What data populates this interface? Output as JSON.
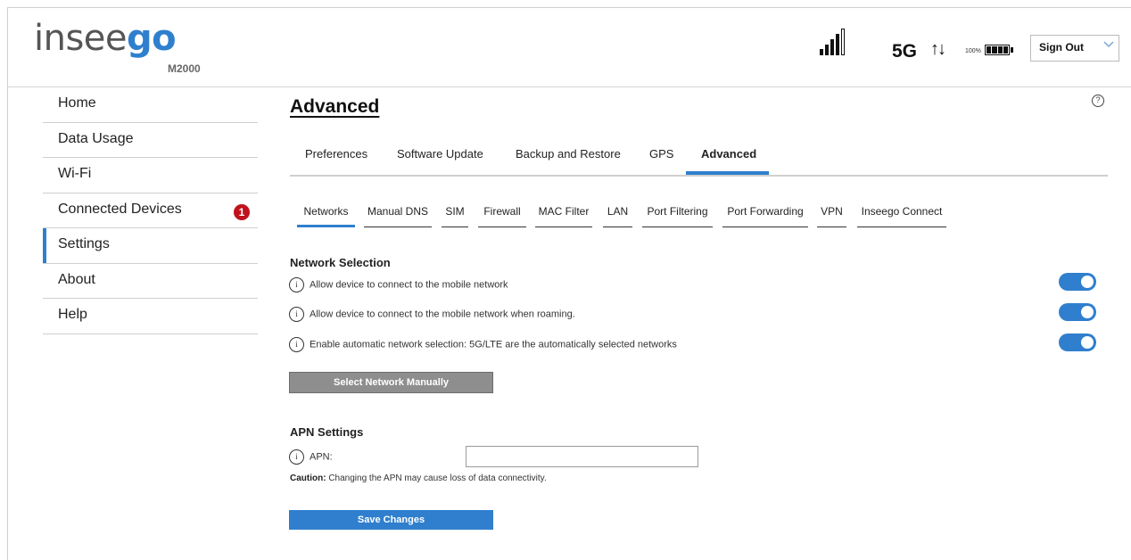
{
  "brand": {
    "logo_part1": "insee",
    "logo_part2": "go",
    "model": "M2000"
  },
  "status": {
    "network_type": "5G",
    "transfer_arrows": "↑↓",
    "battery_percent": "100%",
    "signal_icon": "signal-bars-icon",
    "battery_icon": "battery-icon"
  },
  "header": {
    "sign_out_label": "Sign Out"
  },
  "sidebar": {
    "items": [
      {
        "label": "Home"
      },
      {
        "label": "Data Usage"
      },
      {
        "label": "Wi-Fi"
      },
      {
        "label": "Connected Devices",
        "badge": "1"
      },
      {
        "label": "Settings",
        "active": true
      },
      {
        "label": "About"
      },
      {
        "label": "Help"
      }
    ]
  },
  "main": {
    "title": "Advanced",
    "help_icon": "?",
    "tabs": [
      {
        "label": "Preferences"
      },
      {
        "label": "Software Update"
      },
      {
        "label": "Backup and Restore"
      },
      {
        "label": "GPS"
      },
      {
        "label": "Advanced",
        "active": true
      }
    ],
    "subtabs": [
      {
        "label": "Networks",
        "active": true
      },
      {
        "label": "Manual DNS"
      },
      {
        "label": "SIM"
      },
      {
        "label": "Firewall"
      },
      {
        "label": "MAC Filter"
      },
      {
        "label": "LAN"
      },
      {
        "label": "Port Filtering"
      },
      {
        "label": "Port Forwarding"
      },
      {
        "label": "VPN"
      },
      {
        "label": "Inseego Connect"
      }
    ],
    "network_selection": {
      "title": "Network Selection",
      "settings": [
        {
          "label": "Allow device to connect to the mobile network",
          "enabled": true
        },
        {
          "label": "Allow device to connect to the mobile network when roaming.",
          "enabled": true
        },
        {
          "label": "Enable automatic network selection: 5G/LTE are the automatically selected networks",
          "enabled": true
        }
      ],
      "manual_button": "Select Network Manually"
    },
    "apn_settings": {
      "title": "APN Settings",
      "apn_label": "APN:",
      "apn_value": "",
      "caution_bold": "Caution:",
      "caution_text": " Changing the APN may cause loss of data connectivity."
    },
    "save_button": "Save Changes"
  },
  "colors": {
    "accent": "#2f7fce",
    "badge": "#c0121c",
    "disabled_button": "#8e8e8e"
  }
}
